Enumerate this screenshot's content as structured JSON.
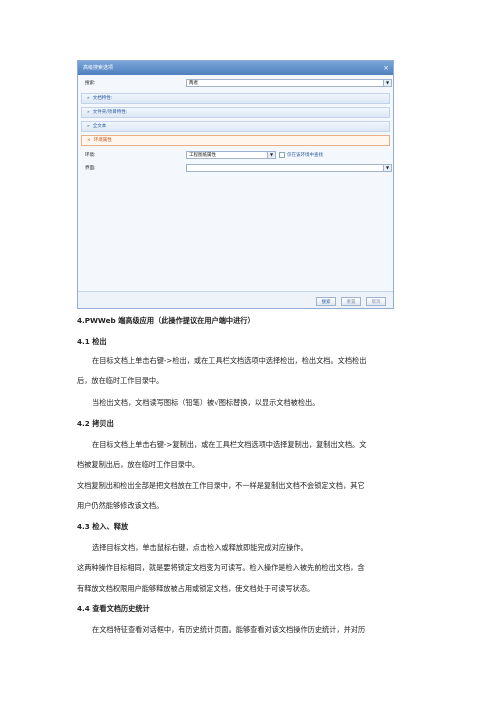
{
  "dialog": {
    "title": "高级搜索选项",
    "close": "×",
    "search_label": "搜索:",
    "search_value": "两者",
    "sections": [
      "文档特性:",
      "文件夹/项目特性:",
      "全文本",
      "环境属性"
    ],
    "env_label": "环境:",
    "env_value": "工程图纸属性",
    "env_checkbox_label": "仅在该环境中查找",
    "interface_label": "界面:",
    "interface_value": "",
    "buttons": {
      "search": "搜索",
      "reset": "重置",
      "cancel": "取消"
    }
  },
  "doc": {
    "h4": "4.PWWeb 端高级应用（此操作提议在用户端中进行）",
    "h41": "4.1 检出",
    "p41a": "在目标文档上单击右键->检出，或在工具栏文档选项中选择检出，检出文档。文档检出",
    "p41b": "后，放在临时工作目录中。",
    "p41c": "当检出文档，文档读写图标（铅笔）被√图标替换，以显示文档被检出。",
    "h42": "4.2 拷贝出",
    "p42a": "在目标文档上单击右键->复制出，或在工具栏文档选项中选择复制出，复制出文档。文",
    "p42b": "档被复制出后，放在临时工作目录中。",
    "p42c": "文档复制出和检出全部是把文档放在工作目录中，不一样是复制出文档不会锁定文档，其它",
    "p42d": "用户仍然能够修改该文档。",
    "h43": "4.3 检入、释放",
    "p43a": "选择目标文档，单击鼠标右键，点击检入或释放即能完成对应操作。",
    "p43b": "这两种操作目标相同，就是要将锁定文档变为可读写。检入操作是检入被先前检出文档，含",
    "p43c": "有释放文档权限用户能够释放被占用或锁定文档，使文档处于可读写状态。",
    "h44": "4.4 查看文档历史统计",
    "p44a": "在文档特征查看对话框中，有历史统计页面。能够查看对该文档操作历史统计，并对历"
  }
}
